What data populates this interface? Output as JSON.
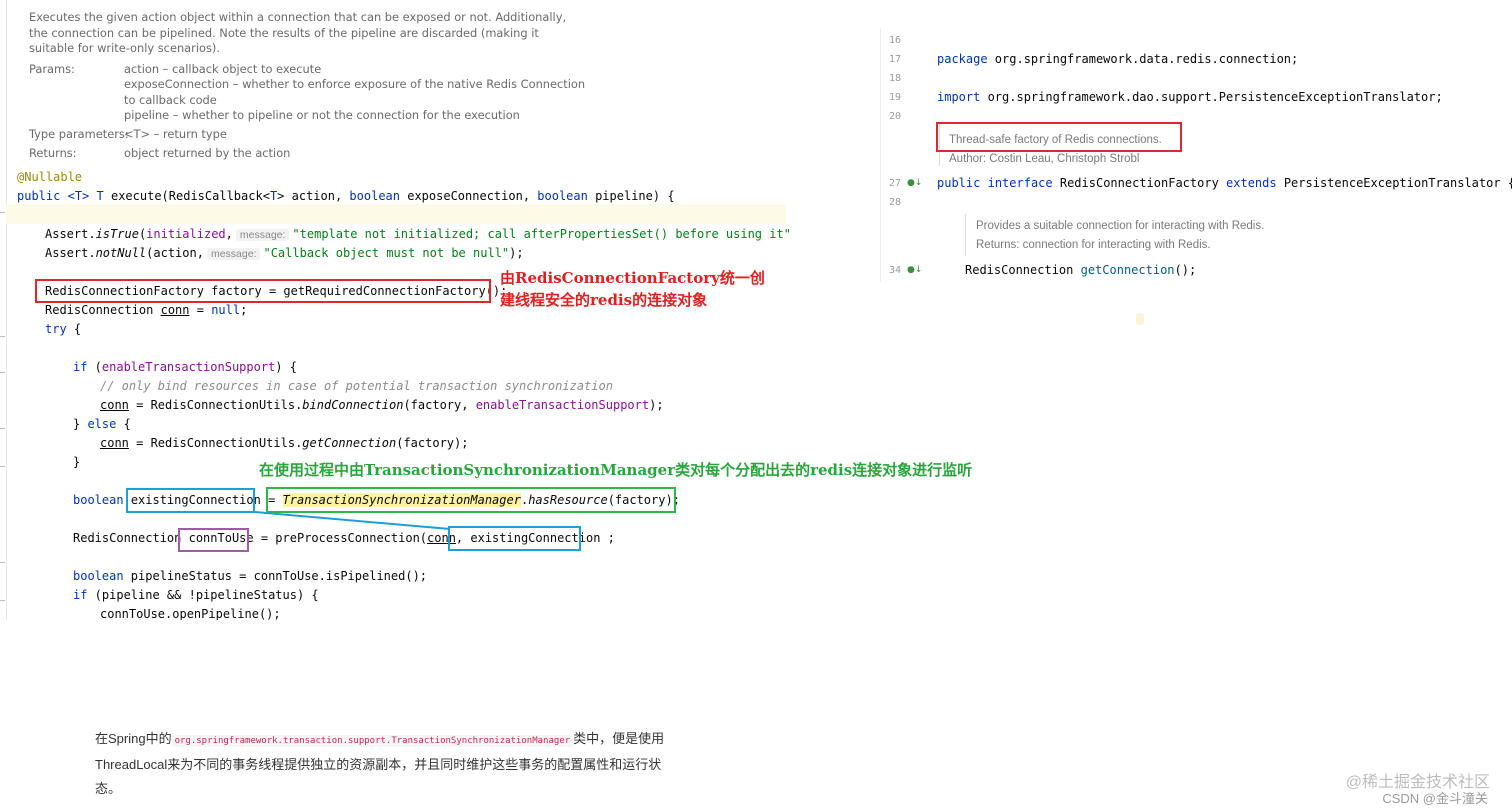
{
  "left_editor": {
    "doc": {
      "description": "Executes the given action object within a connection that can be exposed or not. Additionally, the connection can be pipelined. Note the results of the pipeline are discarded (making it suitable for write-only scenarios).",
      "params_label": "Params:",
      "params": [
        "action – callback object to execute",
        "exposeConnection – whether to enforce exposure of the native Redis Connection",
        "to callback code",
        "pipeline – whether to pipeline or not the connection for the execution"
      ],
      "type_params_label": "Type parameters:",
      "type_params": "<T> – return type",
      "returns_label": "Returns:",
      "returns": "object returned by the action"
    },
    "annotation": "@Nullable",
    "code": {
      "sig_public": "public",
      "sig_generic": "<T>",
      "sig_T": "T",
      "sig_rest_a": "execute(RedisCallback<",
      "sig_rest_b": "T",
      "sig_rest_c": "> action, ",
      "sig_boolean1": "boolean",
      "sig_rest_d": " exposeConnection, ",
      "sig_boolean2": "boolean",
      "sig_rest_e": " pipeline) {",
      "assert1_prefix": "Assert.",
      "assert1_method": "isTrue",
      "assert1_args": "(",
      "assert1_field": "initialized",
      "assert1_comma": ",",
      "assert1_hint": "message:",
      "assert1_string": "\"template not initialized; call afterPropertiesSet() before using it\"",
      "assert1_end": ");",
      "assert2_prefix": "Assert.",
      "assert2_method": "notNull",
      "assert2_args": "(action,",
      "assert2_hint": "message:",
      "assert2_string": "\"Callback object must not be null\"",
      "assert2_end": ");",
      "factory_line": "RedisConnectionFactory factory = getRequiredConnectionFactory();",
      "conn_type": "RedisConnection ",
      "conn_var": "conn",
      "conn_eq": " = ",
      "conn_null": "null",
      "conn_end": ";",
      "try_kw": "try",
      "try_brace": " {",
      "if_kw": "if",
      "if_open": " (",
      "if_field": "enableTransactionSupport",
      "if_close": ") {",
      "comment": "// only bind resources in case of potential transaction synchronization",
      "bind_var": "conn",
      "bind_mid": " = RedisConnectionUtils.",
      "bind_method": "bindConnection",
      "bind_args": "(factory, ",
      "bind_field": "enableTransactionSupport",
      "bind_end": ");",
      "else_open": "} ",
      "else_kw": "else",
      "else_brace": " {",
      "get_var": "conn",
      "get_mid": " = RedisConnectionUtils.",
      "get_method": "getConnection",
      "get_args": "(factory);",
      "close_brace": "}",
      "exist_kw": "boolean",
      "exist_var": "existingConnection",
      "exist_eq": " = ",
      "exist_class": "TransactionSynchronizationManager",
      "exist_dot": ".",
      "exist_method": "hasResource",
      "exist_args": "(factory);",
      "ctu_type": "RedisConnection ",
      "ctu_var": "connToUse",
      "ctu_mid": " = preProcessConnection(",
      "ctu_conn": "conn",
      "ctu_comma": ", ",
      "ctu_arg": "existingConnection",
      "ctu_end": ";",
      "pipe_kw": "boolean",
      "pipe_rest": " pipelineStatus = connToUse.isPipelined();",
      "ifpipe_kw": "if",
      "ifpipe_rest": " (pipeline && !pipelineStatus) {",
      "open_pipe": "connToUse.openPipeline();"
    },
    "annotations": {
      "red_line1": "由RedisConnectionFactory统一创",
      "red_line2": "建线程安全的redis的连接对象",
      "green": "在使用过程中由TransactionSynchronizationManager类对每个分配出去的redis连接对象进行监听"
    }
  },
  "right_editor": {
    "line_numbers": [
      "16",
      "17",
      "18",
      "19",
      "20",
      "27",
      "28",
      "34"
    ],
    "package_kw": "package",
    "package_name": " org.springframework.data.redis.connection;",
    "import_kw": "import",
    "import_name": " org.springframework.dao.support.PersistenceExceptionTranslator;",
    "doc1": "Thread-safe factory of Redis connections.",
    "doc2": "Author: Costin Leau, Christoph Strobl",
    "iface_public": "public",
    "iface_kw": "interface",
    "iface_name": " RedisConnectionFactory ",
    "iface_extends": "extends",
    "iface_rest": " PersistenceExceptionTranslator {",
    "doc3": "Provides a suitable connection for interacting with Redis.",
    "doc4": "Returns: connection for interacting with Redis.",
    "method_type": "RedisConnection ",
    "method_name": "getConnection",
    "method_end": "();"
  },
  "bottom": {
    "text_before": "在Spring中的",
    "code": "org.springframework.transaction.support.TransactionSynchronizationManager",
    "text_after": "类中，便是使用ThreadLocal来为不同的事务线程提供独立的资源副本，并且同时维护这些事务的配置属性和运行状态。"
  },
  "watermarks": {
    "juejin": "@稀土掘金技术社区",
    "csdn": "CSDN @金斗潼关"
  },
  "colors": {
    "keyword": "#0033b3",
    "string": "#067d17",
    "field": "#871094",
    "annotation_red": "#e0262e",
    "annotation_green": "#2db84a",
    "annotation_blue": "#1b9fd4",
    "annotation_purple": "#a05aa6"
  }
}
